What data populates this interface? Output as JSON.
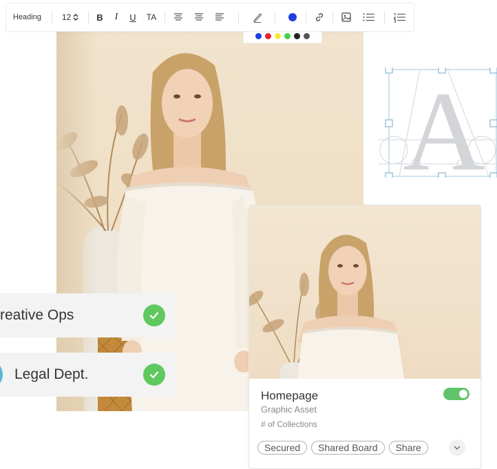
{
  "toolbar": {
    "heading_label": "Heading",
    "font_size": "12",
    "bold": "B",
    "italic": "I",
    "underline": "U",
    "text_case": "TA",
    "active_color": "#1f3fe0",
    "icons": [
      "align-left-icon",
      "align-center-icon",
      "align-right-icon",
      "pen-icon",
      "color-icon",
      "link-icon",
      "image-icon",
      "bullet-list-icon",
      "numbered-list-icon"
    ]
  },
  "palette": {
    "swatches": [
      "#1f3fe0",
      "#e8242e",
      "#f4e83a",
      "#44d24a",
      "#222222",
      "#555555"
    ]
  },
  "card": {
    "title": "Homepage",
    "subtitle": "Graphic Asset",
    "meta": "# of Collections",
    "toggle_on": true,
    "toggle_color": "#62c46a",
    "tags": [
      "Secured",
      "Shared Board",
      "Share"
    ]
  },
  "approvals": [
    {
      "label": "reative Ops",
      "status": "approved"
    },
    {
      "label": "Legal Dept.",
      "status": "approved"
    }
  ],
  "typography_glyph": "A"
}
